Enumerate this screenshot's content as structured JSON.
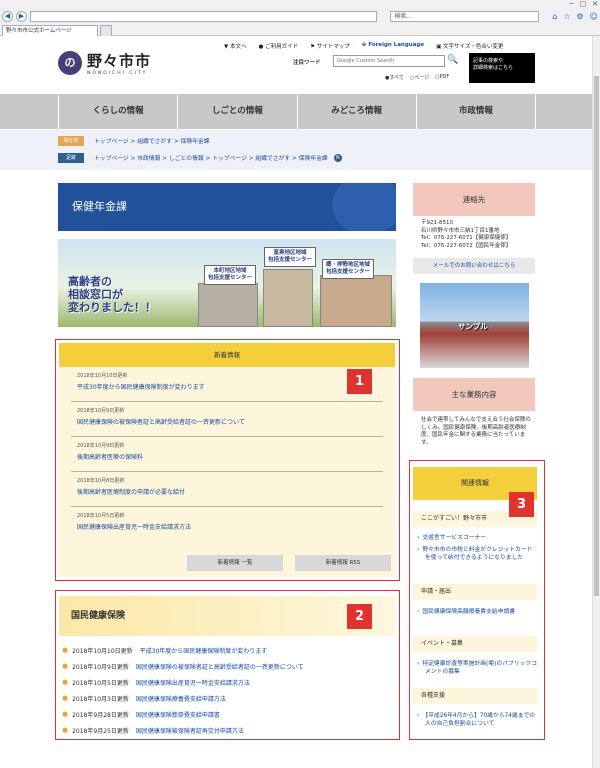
{
  "browser": {
    "address_placeholder": "",
    "search_placeholder": "検索...",
    "tab_title": "野々市市公式ホームページ"
  },
  "header": {
    "logo_jp": "野々市市",
    "logo_en": "NONOICHI CITY",
    "logo_mark": "ののいち",
    "top_links": [
      "本文へ",
      "ご利用ガイド",
      "サイトマップ",
      "Foreign Language",
      "文字サイズ・色合い変更"
    ],
    "search_label": "注目ワード",
    "search_placeholder": "Google Custom Search",
    "search_options": [
      "すべて",
      "ページ",
      "PDF"
    ],
    "detail_search": "記事の検索や\n詳細検索はこちら"
  },
  "nav": [
    "くらしの情報",
    "しごとの情報",
    "みどころ情報",
    "市政情報"
  ],
  "breadcrumbs": {
    "current_tag": "現在地",
    "current": "トップページ > 組織でさがす > 保険年金課",
    "history_tag": "足跡",
    "history": "トップページ > 市政情報 > しごとの情報 > トップページ > 組織でさがす > 保険年金課"
  },
  "page_title": "保健年金課",
  "hero": {
    "headline": "高齢者の\n相談窓口が\n変わりました！！",
    "bubble1": "本町地区地域\n包括支援センター",
    "bubble2": "富奥地区地域\n包括支援センター",
    "bubble3": "郷・押野地区地域\n包括支援センター"
  },
  "news": {
    "title": "新着情報",
    "items": [
      {
        "date": "2018年10月10日更新",
        "title": "平成30年度から国民健康保険制度が変わります"
      },
      {
        "date": "2018年10月9日更新",
        "title": "国民健康保険の被保険者証と高齢受給者証の一斉更新について"
      },
      {
        "date": "2018年10月9日更新",
        "title": "後期高齢者医療の保険料"
      },
      {
        "date": "2018年10月8日更新",
        "title": "後期高齢者医療制度の申請が必要な給付"
      },
      {
        "date": "2018年10月5日更新",
        "title": "国民健康保険出産育児一時金支給請求方法"
      }
    ],
    "list_button": "新着情報 一覧",
    "rss_button": "新着情報 RSS"
  },
  "kokumin": {
    "title": "国民健康保険",
    "items": [
      {
        "date": "2018年10月10日更新",
        "title": "平成30年度から国民健康保険制度が変わります"
      },
      {
        "date": "2018年10月9日更新",
        "title": "国民健康保険の被保険者証と高齢受給者証の一斉更新について"
      },
      {
        "date": "2018年10月5日更新",
        "title": "国民健康保険出産育児一時金支給請求方法"
      },
      {
        "date": "2018年10月3日更新",
        "title": "国民健康保険療養費支給申請方法"
      },
      {
        "date": "2018年9月28日更新",
        "title": "国民健康保険葬祭費支給申請書"
      },
      {
        "date": "2018年9月25日更新",
        "title": "国民健康保険被保険者証再交付申請方法"
      }
    ]
  },
  "sidebar": {
    "contact_title": "連絡先",
    "contact_lines": [
      "〒921-8510",
      "石川県野々市市三納1丁目1番地",
      "Tel：076-227-6071【健康保健係】",
      "Tel：076-227-6072【国民年金係】"
    ],
    "mail_link": "メールでのお問い合わせはこちら",
    "photo_label": "サンプル",
    "business_title": "主な業務内容",
    "business_text": "社会で連帯してみんなで支え合う社会保障のしくみ。国民健康保険、後期高齢者医療制度、国民年金に関する業務に当たっています。",
    "related_title": "関連情報",
    "related": {
      "sec1": "ここがすごい！野々市市",
      "link1": "交遊舎サービスコーナー",
      "link2": "野々市市の市税と料金がクレジットカードを使って納付できるようになりました",
      "sec2": "申請・届出",
      "link3": "国民健康保険高額療養費支給申請書",
      "sec3": "イベント・募集",
      "link4": "特定健康診査等実施計画(案)のパブリックコメントの募集",
      "sec4": "各種支援",
      "link5": "【平成26年4月から】70歳から74歳までの人の自己負担割合について"
    }
  },
  "annotations": [
    "1",
    "2",
    "3"
  ]
}
